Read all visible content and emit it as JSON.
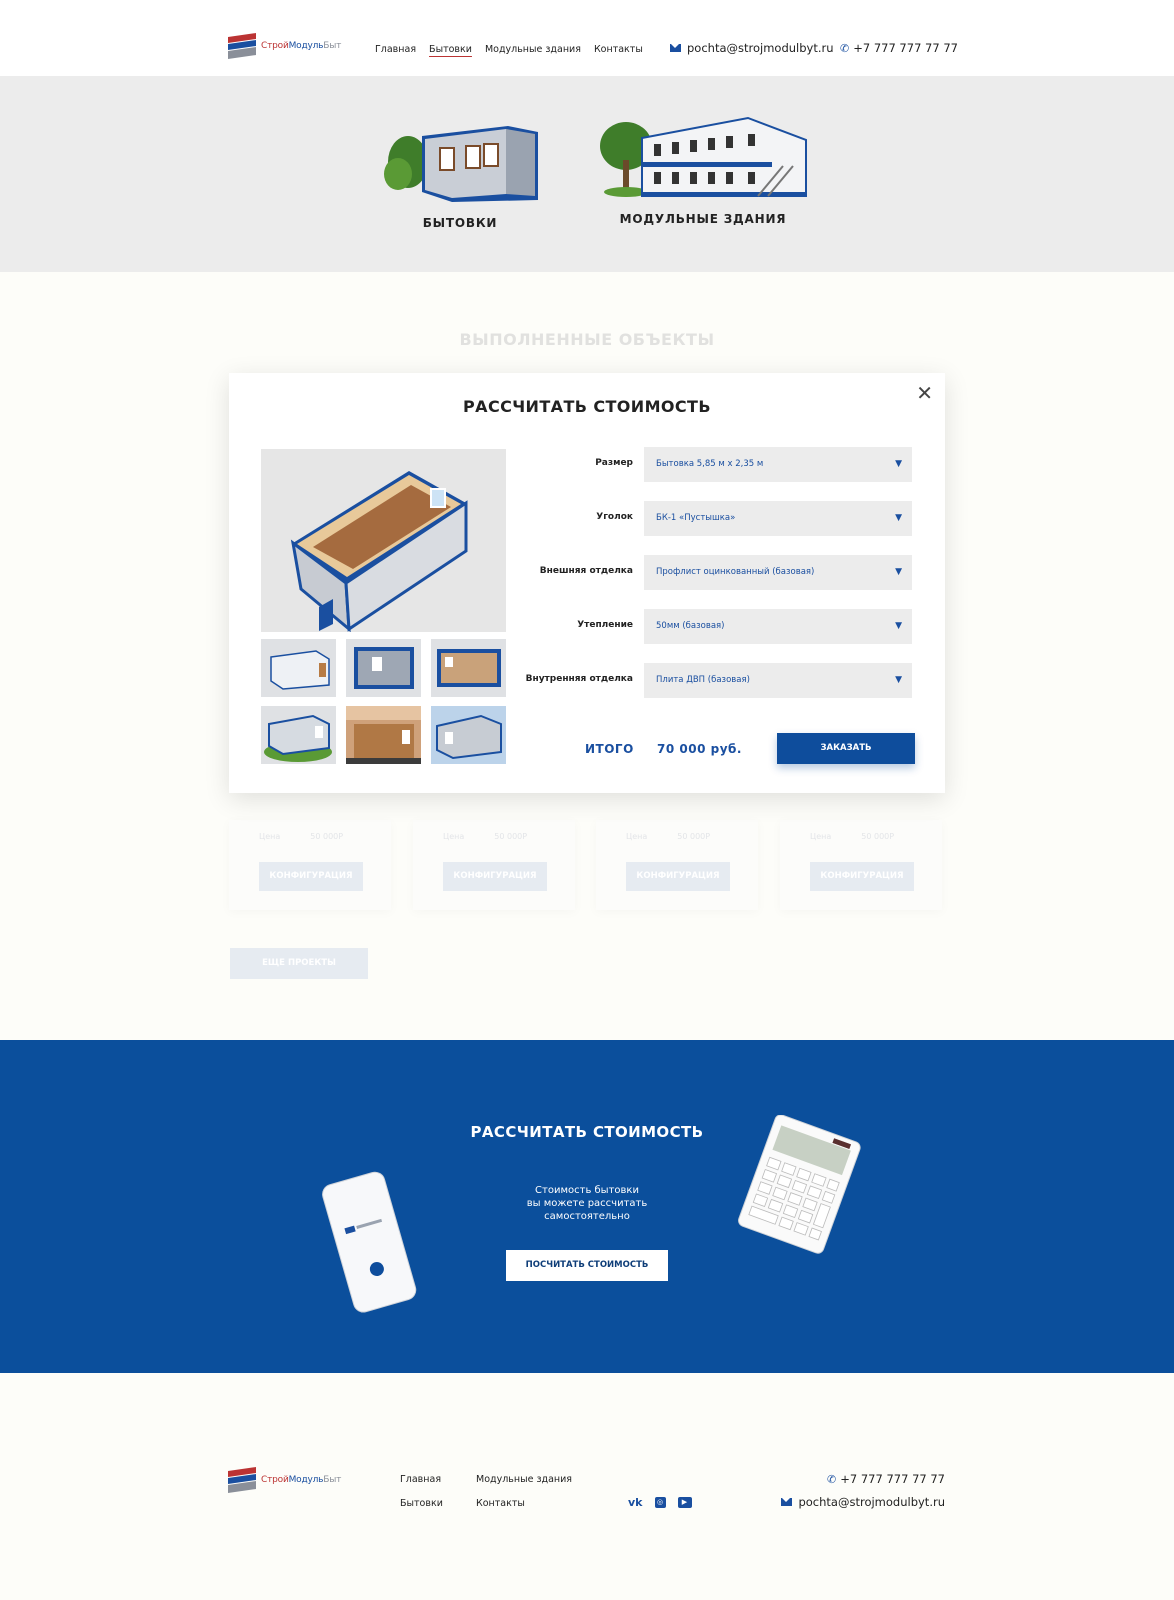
{
  "header": {
    "logo": {
      "part1": "Строй",
      "part2": "Модуль",
      "part3": "Быт"
    },
    "nav": [
      {
        "label": "Главная",
        "active": false
      },
      {
        "label": "Бытовки",
        "active": true
      },
      {
        "label": "Модульные здания",
        "active": false
      },
      {
        "label": "Контакты",
        "active": false
      }
    ],
    "email": "pochta@strojmodulbyt.ru",
    "phone": "+7 777 777 77 77"
  },
  "categories": [
    {
      "label": "БЫТОВКИ"
    },
    {
      "label": "МОДУЛЬНЫЕ ЗДАНИЯ"
    }
  ],
  "section_title": "ВЫПОЛНЕННЫЕ ОБЪЕКТЫ",
  "project_cards": [
    {
      "price_label": "Цена",
      "price": "50 000Р",
      "button": "КОНФИГУРАЦИЯ"
    },
    {
      "price_label": "Цена",
      "price": "50 000Р",
      "button": "КОНФИГУРАЦИЯ"
    },
    {
      "price_label": "Цена",
      "price": "50 000Р",
      "button": "КОНФИГУРАЦИЯ"
    },
    {
      "price_label": "Цена",
      "price": "50 000Р",
      "button": "КОНФИГУРАЦИЯ"
    }
  ],
  "more_button": "ЕЩЕ ПРОЕКТЫ",
  "modal": {
    "title": "РАССЧИТАТЬ СТОИМОСТЬ",
    "fields": [
      {
        "label": "Размер",
        "value": "Бытовка 5,85 м х 2,35 м"
      },
      {
        "label": "Уголок",
        "value": "БК-1 «Пустышка»"
      },
      {
        "label": "Внешняя отделка",
        "value": "Профлист оцинкованный (базовая)"
      },
      {
        "label": "Утепление",
        "value": "50мм (базовая)"
      },
      {
        "label": "Внутренняя отделка",
        "value": "Плита ДВП (базовая)"
      }
    ],
    "total_label": "ИТОГО",
    "total_value": "70 000 руб.",
    "order_button": "ЗАКАЗАТЬ"
  },
  "calc_section": {
    "title": "РАССЧИТАТЬ СТОИМОСТЬ",
    "text_line1": "Стоимость бытовки",
    "text_line2": "вы можете рассчитать",
    "text_line3": "самостоятельно",
    "button": "ПОСЧИТАТЬ СТОИМОСТЬ"
  },
  "footer": {
    "links": [
      "Главная",
      "Модульные здания",
      "Бытовки",
      "Контакты"
    ],
    "socials": [
      "vk-icon",
      "instagram-icon",
      "youtube-icon"
    ],
    "phone": "+7 777 777 77 77",
    "email": "pochta@strojmodulbyt.ru"
  },
  "colors": {
    "brand_blue": "#0b4f9c",
    "brand_red": "#b33333",
    "brand_grey": "#8a8f99"
  }
}
